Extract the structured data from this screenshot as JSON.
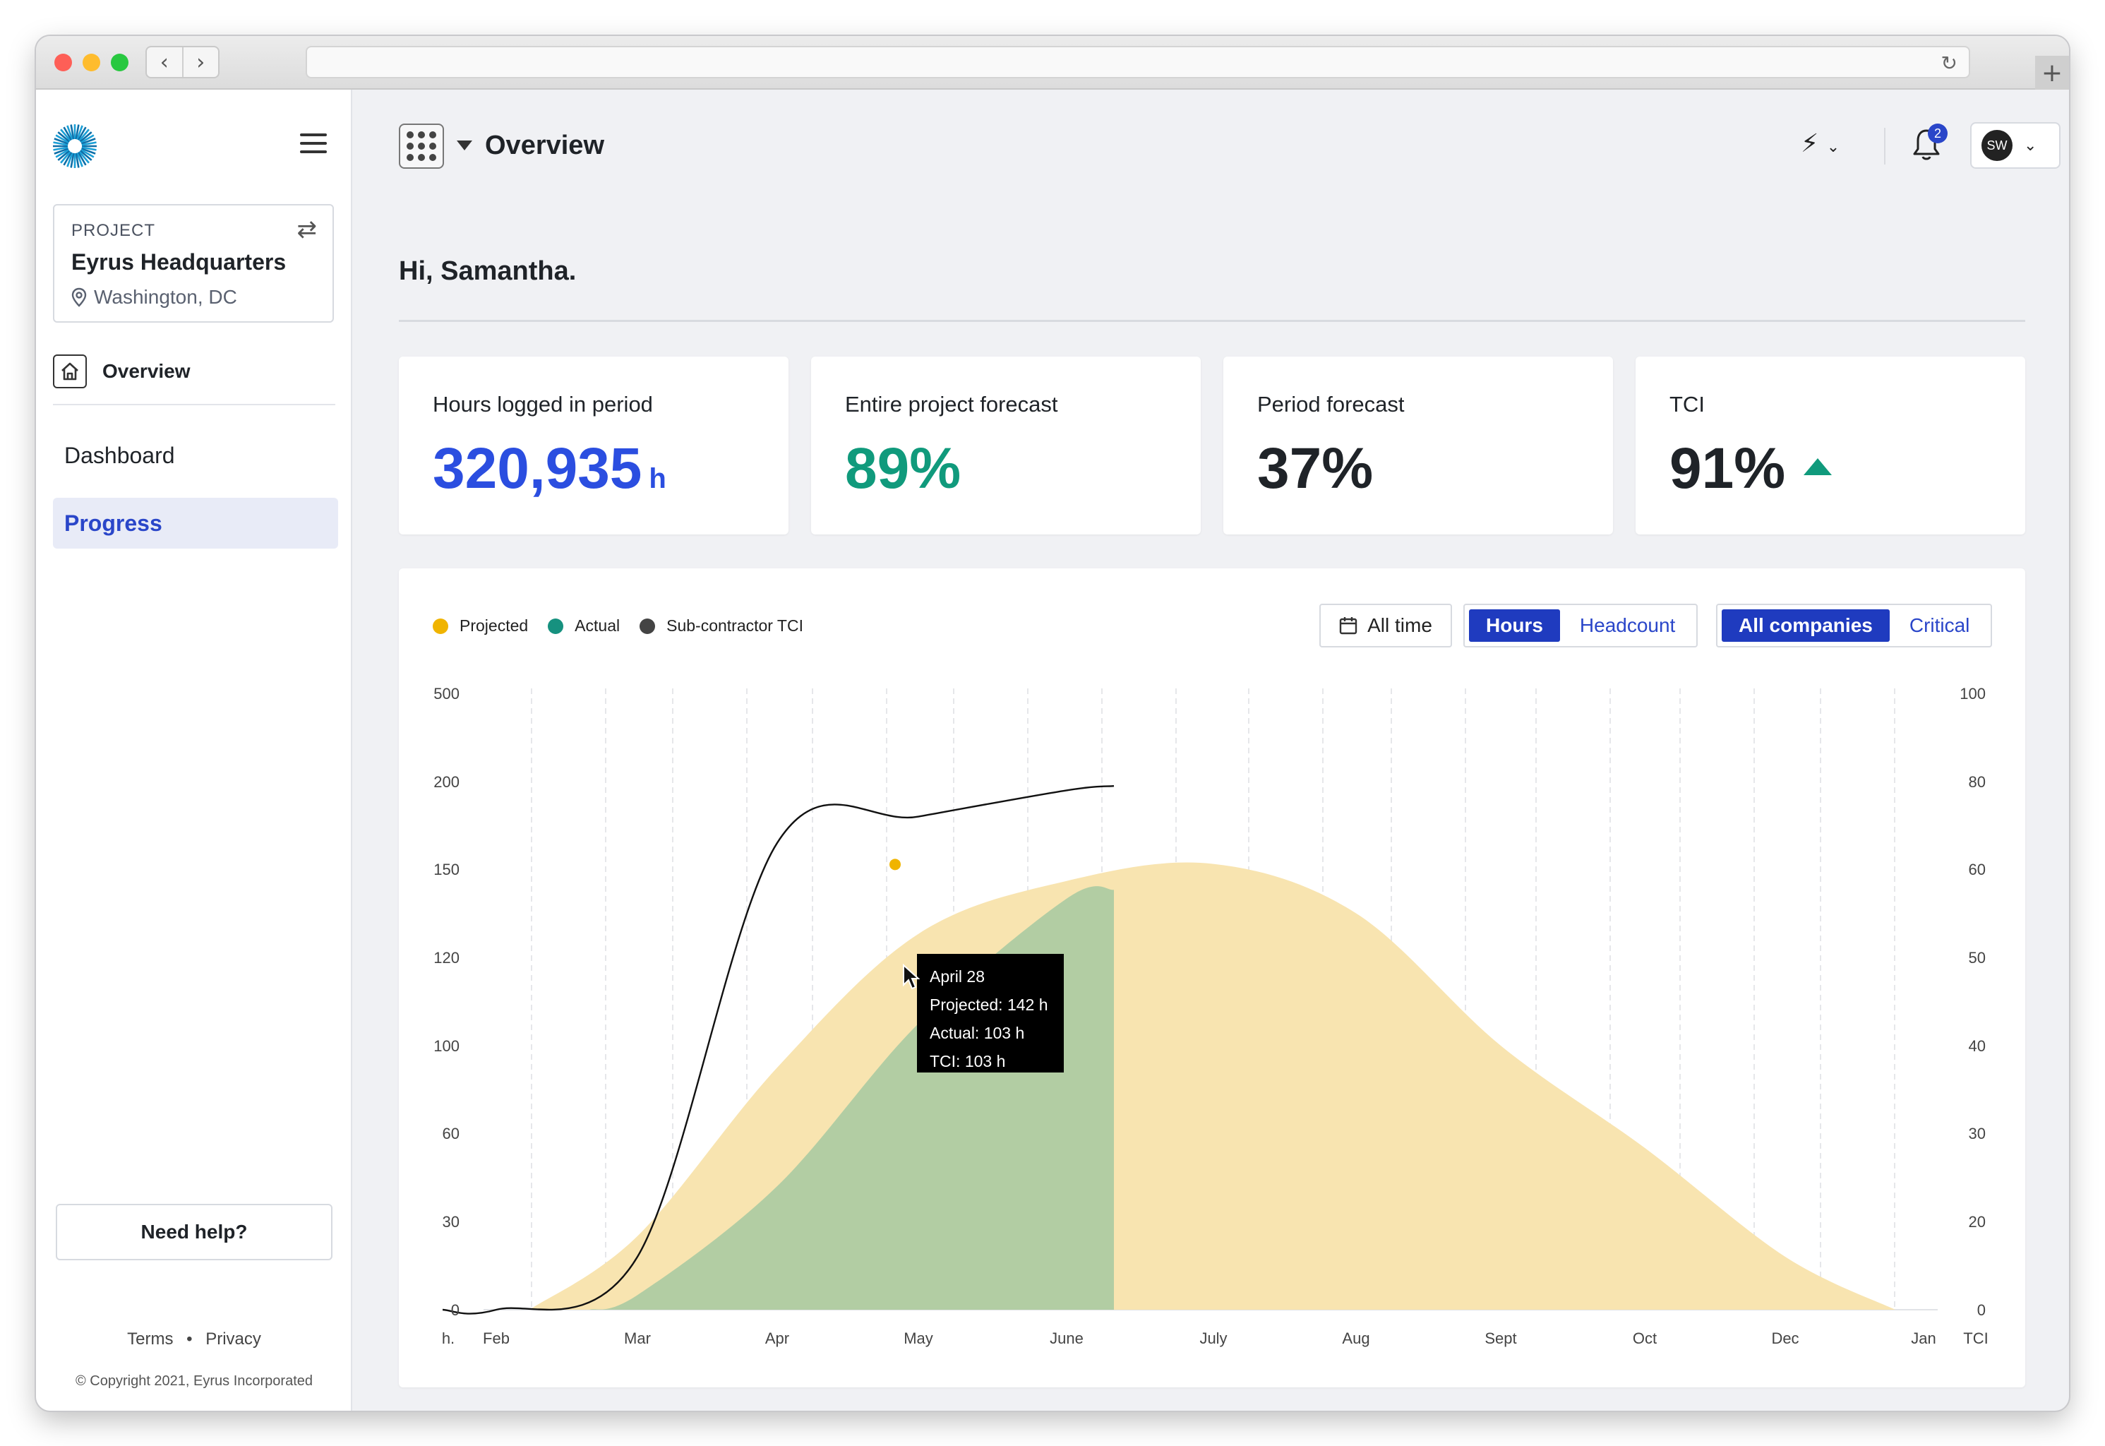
{
  "app": {
    "title": "Overview",
    "notifications_count": "2",
    "user_initials": "SW"
  },
  "sidebar": {
    "project_label": "PROJECT",
    "project_name": "Eyrus Headquarters",
    "project_location": "Washington, DC",
    "overview_label": "Overview",
    "items": [
      {
        "label": "Dashboard",
        "active": false
      },
      {
        "label": "Progress",
        "active": true
      }
    ],
    "help_label": "Need help?",
    "links": [
      "Terms",
      "Privacy"
    ],
    "copyright": "© Copyright 2021, Eyrus Incorporated"
  },
  "main": {
    "greeting": "Hi, Samantha.",
    "kpis": [
      {
        "label": "Hours logged in period",
        "value": "320,935",
        "unit": "h",
        "color": "#2b4ee0"
      },
      {
        "label": "Entire project forecast",
        "value": "89%",
        "color": "#109a7c"
      },
      {
        "label": "Period forecast",
        "value": "37%",
        "color": "#1f2328"
      },
      {
        "label": "TCI",
        "value": "91%",
        "color": "#1f2328",
        "trend": "up"
      }
    ]
  },
  "chart_controls": {
    "date_range": "All time",
    "metric_options": [
      "Hours",
      "Headcount"
    ],
    "metric_selected": "Hours",
    "company_options": [
      "All companies",
      "Critical"
    ],
    "company_selected": "All companies"
  },
  "tooltip": {
    "date": "April 28",
    "projected": "Projected: 142 h",
    "actual": "Actual: 103 h",
    "tci": "TCI: 103 h"
  },
  "colors": {
    "projected": "#f0b400",
    "projected_fill": "#f8e4b0",
    "actual": "#16917f",
    "actual_fill": "#b2cda3",
    "tci": "#444444",
    "accent": "#1f3bbf"
  },
  "chart_data": {
    "type": "area",
    "legend": [
      "Projected",
      "Actual",
      "Sub-contractor TCI"
    ],
    "x_ticks": [
      "Feb",
      "Mar",
      "Apr",
      "May",
      "June",
      "July",
      "Aug",
      "Sept",
      "Oct",
      "Dec",
      "Jan"
    ],
    "x_label_left": "h.",
    "x_label_right": "TCI",
    "y_left_ticks": [
      "0",
      "30",
      "60",
      "100",
      "120",
      "150",
      "200",
      "500"
    ],
    "y_right_ticks": [
      "0",
      "20",
      "30",
      "40",
      "50",
      "60",
      "80",
      "100"
    ],
    "grid": "vertical dashed",
    "series": [
      {
        "name": "Projected",
        "axis": "left",
        "points": [
          [
            "Feb",
            0
          ],
          [
            "Mar",
            25
          ],
          [
            "Apr",
            90
          ],
          [
            "May",
            128
          ],
          [
            "June",
            146
          ],
          [
            "July",
            153
          ],
          [
            "Aug",
            135
          ],
          [
            "Sept",
            100
          ],
          [
            "Oct",
            55
          ],
          [
            "Dec",
            18
          ],
          [
            "Jan",
            0
          ]
        ]
      },
      {
        "name": "Actual",
        "axis": "left",
        "points": [
          [
            "Feb",
            0
          ],
          [
            "Mar",
            5
          ],
          [
            "Apr",
            42
          ],
          [
            "May",
            105
          ],
          [
            "June",
            140
          ],
          [
            "June+",
            143
          ]
        ]
      },
      {
        "name": "Sub-contractor TCI",
        "axis": "right",
        "points": [
          [
            "Feb",
            0
          ],
          [
            "Mar",
            12
          ],
          [
            "Apr",
            66
          ],
          [
            "May",
            72
          ],
          [
            "June",
            78
          ],
          [
            "June+",
            79
          ]
        ]
      }
    ],
    "highlight": {
      "date": "April 28",
      "projected": 142,
      "actual": 103,
      "tci": 103
    }
  }
}
